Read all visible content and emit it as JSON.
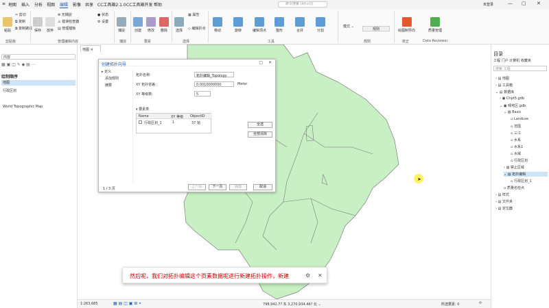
{
  "titlebar": {
    "tabs": [
      "地图",
      "插入",
      "分析",
      "视图",
      "编辑",
      "影像",
      "共享",
      "CC工具箱2.1.0",
      "CC工具箱开发",
      "帮助"
    ],
    "active_tab": 4,
    "search_placeholder": "命令搜索 (Alt+Q)",
    "user": "未登录"
  },
  "ribbon": {
    "clipboard": {
      "paste": "粘贴",
      "cut": "剪切",
      "copy": "复制",
      "copy_path": "复制路径",
      "label": "剪贴板"
    },
    "buttons": {
      "save": "保存",
      "discard": "放弃",
      "snapping_label": "无捕捉",
      "error_inspector": "错误检查器",
      "manage_templates": "管理模板",
      "manage_edit_content": "管理编辑内容",
      "status": "状态",
      "settings": "设置",
      "snap": "捕捉",
      "create": "创建",
      "modify": "修改",
      "delete": "删除",
      "select": "选择",
      "attributes": "属性",
      "edit_vertices": "编辑折点",
      "move": "移动",
      "rotate": "旋转",
      "scale": "编辑顶点",
      "reshape": "整形",
      "merge": "合并",
      "split": "分割",
      "rules": "规则",
      "mode": "模式",
      "topology": "拓扑",
      "verify": "校正",
      "drawing_tool": "绘图制导向",
      "quality": "质量管理",
      "data_reviewer": "Data Reviewer"
    },
    "groups": [
      "剪贴板",
      "管理编辑内容",
      "捕捉",
      "要素",
      "选择",
      "工具",
      "校正"
    ]
  },
  "leftpanel": {
    "search": "内容",
    "heading": "绘制顺序",
    "items": [
      "地图",
      "行政区划",
      "World Topographic Map"
    ]
  },
  "map": {
    "tab_label": "地图",
    "fill": "#c8f0c4",
    "stroke": "#7a7a7a"
  },
  "dialog": {
    "title": "创建拓扑向导",
    "nav": [
      "定义",
      "添加规则",
      "摘要"
    ],
    "fields": {
      "name_label": "拓扑名称:",
      "name_value": "拓扑编辑_Topology",
      "xy_label": "XY 拓扑容差:",
      "xy_value": "0.0010000000",
      "xy_unit": "Meter",
      "z_label": "XY 等级数:",
      "z_value": "5"
    },
    "section": "要素类",
    "table": {
      "columns": [
        "Name",
        "XY 等级",
        "ObjectID"
      ],
      "rows": [
        [
          "行政区划_1",
          "1",
          "37 铭"
        ]
      ]
    },
    "buttons": {
      "select_all": "全选",
      "clear_all": "全部清除",
      "prev": "上一页",
      "next": "下一页",
      "finish": "完成",
      "cancel": "取消"
    },
    "page": "1 / 3 页"
  },
  "rightpanel": {
    "title": "目录",
    "tabs": [
      "工程",
      "门户",
      "计算机",
      "收藏夹"
    ],
    "search": "搜索 工程",
    "items": [
      "地图",
      "工具箱",
      "数据库",
      "Chpt5.gdb",
      "晴宅区.gdb",
      "Basic",
      "Landuse",
      "范围",
      "三江",
      "水系",
      "水系1",
      "水域",
      "行政区划",
      "禁止区域",
      "拓扑编辑",
      "行政区划_1",
      "拓扑编辑",
      "质量名检点",
      "样式",
      "文件夹",
      "定位器"
    ]
  },
  "statusbar": {
    "scale": "1:263,685",
    "coords": "798,942.7? 东 3,270,934.46? 北 ⌄",
    "selected": "所选要素: 0"
  },
  "subtitle": {
    "text": "然后呢，我们对拓扑编辑这个页素数据呢进行新建拓扑操作，新建"
  }
}
